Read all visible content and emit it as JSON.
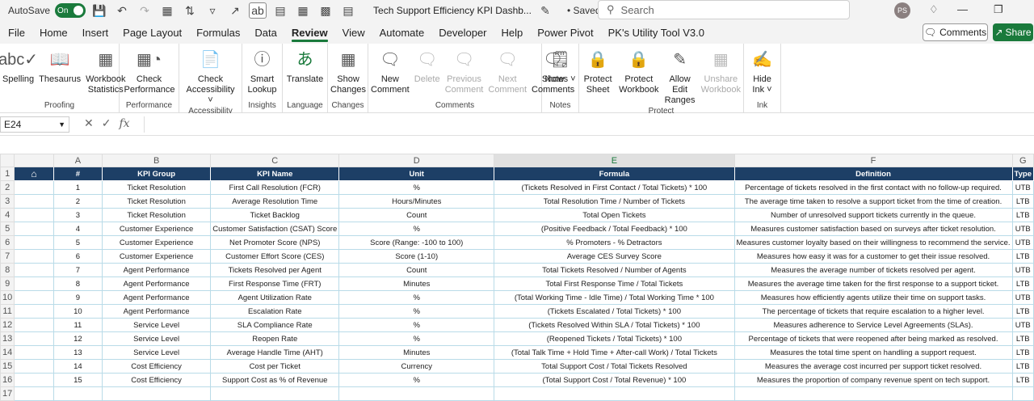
{
  "titlebar": {
    "autosave_label": "AutoSave",
    "autosave_state": "On",
    "doc_title": "Tech Support Efficiency KPI Dashb...",
    "saved": "• Saved",
    "search_placeholder": "Search",
    "avatar_initials": "PS"
  },
  "menu": {
    "items": [
      "File",
      "Home",
      "Insert",
      "Page Layout",
      "Formulas",
      "Data",
      "Review",
      "View",
      "Automate",
      "Developer",
      "Help",
      "Power Pivot",
      "PK's Utility Tool V3.0"
    ],
    "active": "Review",
    "comments_button": "Comments",
    "share_button": "Share"
  },
  "ribbon": {
    "groups": [
      {
        "label": "Proofing",
        "buttons": [
          {
            "label": "Spelling",
            "icon": "spelling-icon"
          },
          {
            "label": "Thesaurus",
            "icon": "thesaurus-icon"
          },
          {
            "label": "Workbook Statistics",
            "icon": "workbook-statistics-icon"
          }
        ]
      },
      {
        "label": "Performance",
        "buttons": [
          {
            "label": "Check Performance",
            "icon": "check-performance-icon"
          }
        ]
      },
      {
        "label": "Accessibility",
        "buttons": [
          {
            "label": "Check Accessibility ˅",
            "icon": "check-accessibility-icon"
          }
        ]
      },
      {
        "label": "Insights",
        "buttons": [
          {
            "label": "Smart Lookup",
            "icon": "smart-lookup-icon"
          }
        ]
      },
      {
        "label": "Language",
        "buttons": [
          {
            "label": "Translate",
            "icon": "translate-icon"
          }
        ]
      },
      {
        "label": "Changes",
        "buttons": [
          {
            "label": "Show Changes",
            "icon": "show-changes-icon"
          }
        ]
      },
      {
        "label": "Comments",
        "buttons": [
          {
            "label": "New Comment",
            "icon": "new-comment-icon"
          },
          {
            "label": "Delete",
            "icon": "delete-comment-icon",
            "disabled": true
          },
          {
            "label": "Previous Comment",
            "icon": "previous-comment-icon",
            "disabled": true
          },
          {
            "label": "Next Comment",
            "icon": "next-comment-icon",
            "disabled": true
          },
          {
            "label": "Show Comments",
            "icon": "show-comments-icon"
          }
        ]
      },
      {
        "label": "Notes",
        "buttons": [
          {
            "label": "Notes ˅",
            "icon": "notes-icon"
          }
        ]
      },
      {
        "label": "Protect",
        "buttons": [
          {
            "label": "Protect Sheet",
            "icon": "protect-sheet-icon"
          },
          {
            "label": "Protect Workbook",
            "icon": "protect-workbook-icon"
          },
          {
            "label": "Allow Edit Ranges",
            "icon": "allow-edit-ranges-icon"
          },
          {
            "label": "Unshare Workbook",
            "icon": "unshare-workbook-icon",
            "disabled": true
          }
        ]
      },
      {
        "label": "Ink",
        "buttons": [
          {
            "label": "Hide Ink ˅",
            "icon": "hide-ink-icon"
          }
        ]
      }
    ]
  },
  "formula_bar": {
    "name_box": "E24",
    "formula": ""
  },
  "sheet": {
    "columns": [
      "A",
      "B",
      "C",
      "D",
      "E",
      "F",
      "G"
    ],
    "selected_column": "E",
    "header": [
      "#",
      "KPI Group",
      "KPI Name",
      "Unit",
      "Formula",
      "Definition",
      "Type"
    ],
    "rows": [
      [
        "1",
        "Ticket Resolution",
        "First Call Resolution (FCR)",
        "%",
        "(Tickets Resolved in First Contact / Total Tickets) * 100",
        "Percentage of tickets resolved in the first contact with no follow-up required.",
        "UTB"
      ],
      [
        "2",
        "Ticket Resolution",
        "Average Resolution Time",
        "Hours/Minutes",
        "Total Resolution Time / Number of Tickets",
        "The average time taken to resolve a support ticket from the time of creation.",
        "LTB"
      ],
      [
        "3",
        "Ticket Resolution",
        "Ticket Backlog",
        "Count",
        "Total Open Tickets",
        "Number of unresolved support tickets currently in the queue.",
        "LTB"
      ],
      [
        "4",
        "Customer Experience",
        "Customer Satisfaction (CSAT) Score",
        "%",
        "(Positive Feedback / Total Feedback) * 100",
        "Measures customer satisfaction based on surveys after ticket resolution.",
        "UTB"
      ],
      [
        "5",
        "Customer Experience",
        "Net Promoter Score (NPS)",
        "Score (Range: -100 to 100)",
        "% Promoters - % Detractors",
        "Measures customer loyalty based on their willingness to recommend the service.",
        "UTB"
      ],
      [
        "6",
        "Customer Experience",
        "Customer Effort Score (CES)",
        "Score (1-10)",
        "Average CES Survey Score",
        "Measures how easy it was for a customer to get their issue resolved.",
        "LTB"
      ],
      [
        "7",
        "Agent Performance",
        "Tickets Resolved per Agent",
        "Count",
        "Total Tickets Resolved / Number of Agents",
        "Measures the average number of tickets resolved per agent.",
        "UTB"
      ],
      [
        "8",
        "Agent Performance",
        "First Response Time (FRT)",
        "Minutes",
        "Total First Response Time / Total Tickets",
        "Measures the average time taken for the first response to a support ticket.",
        "LTB"
      ],
      [
        "9",
        "Agent Performance",
        "Agent Utilization Rate",
        "%",
        "(Total Working Time - Idle Time) / Total Working Time * 100",
        "Measures how efficiently agents utilize their time on support tasks.",
        "UTB"
      ],
      [
        "10",
        "Agent Performance",
        "Escalation Rate",
        "%",
        "(Tickets Escalated / Total Tickets) * 100",
        "The percentage of tickets that require escalation to a higher level.",
        "LTB"
      ],
      [
        "11",
        "Service Level",
        "SLA Compliance Rate",
        "%",
        "(Tickets Resolved Within SLA / Total Tickets) * 100",
        "Measures adherence to Service Level Agreements (SLAs).",
        "UTB"
      ],
      [
        "12",
        "Service Level",
        "Reopen Rate",
        "%",
        "(Reopened Tickets / Total Tickets) * 100",
        "Percentage of tickets that were reopened after being marked as resolved.",
        "LTB"
      ],
      [
        "13",
        "Service Level",
        "Average Handle Time (AHT)",
        "Minutes",
        "(Total Talk Time + Hold Time + After-call Work) / Total Tickets",
        "Measures the total time spent on handling a support request.",
        "LTB"
      ],
      [
        "14",
        "Cost Efficiency",
        "Cost per Ticket",
        "Currency",
        "Total Support Cost / Total Tickets Resolved",
        "Measures the average cost incurred per support ticket resolved.",
        "LTB"
      ],
      [
        "15",
        "Cost Efficiency",
        "Support Cost as % of Revenue",
        "%",
        "(Total Support Cost / Total Revenue) * 100",
        "Measures the proportion of company revenue spent on tech support.",
        "LTB"
      ]
    ],
    "row_numbers": [
      "1",
      "2",
      "3",
      "4",
      "5",
      "6",
      "7",
      "8",
      "9",
      "10",
      "11",
      "12",
      "13",
      "14",
      "15",
      "16",
      "17"
    ]
  }
}
